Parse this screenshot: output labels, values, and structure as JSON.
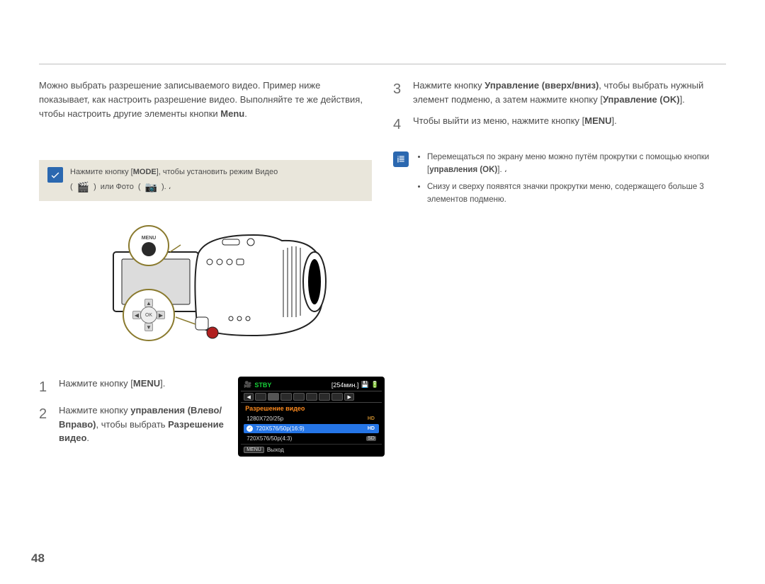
{
  "page_number": "48",
  "left": {
    "intro": "Можно выбрать разрешение записываемого видео.",
    "menu_word": "Menu",
    "preverify": {
      "line1_prefix": "Нажмите кнопку [",
      "mode": "MODE",
      "line1_suffix": "], чтобы установить режим Видео",
      "line2_prefix": "( ",
      "line2_mid": " ) или Фото ( ",
      "line2_suffix": " ). ،",
      "video_glyph": "🎬",
      "photo_glyph": "📷"
    },
    "callout_menu_label": "MENU",
    "navpad_ok": "OK",
    "step1_num": "1",
    "step1_a": "Нажмите кнопку [",
    "step1_menu": "MENU",
    "step1_b": "].",
    "step2_num": "2",
    "step2_a": "Нажмите кнопку ",
    "step2_b": "управления",
    "step2_c": " (Влево/Вправо)",
    "step2_d": ", чтобы выбрать ",
    "step2_e": "Разрешение видео",
    "step2_f": "."
  },
  "lcd": {
    "stby": "STBY",
    "time": "[254мин.]",
    "title": "Разрешение видео",
    "rows": [
      {
        "label": "1280X720/25p",
        "tag": "HD"
      },
      {
        "label": "720X576/50p(16:9)",
        "tag": "HD"
      },
      {
        "label": "720X576/50p(4:3)",
        "tag": "SD"
      }
    ],
    "menu_btn": "MENU",
    "exit": "Выход"
  },
  "right": {
    "step3_num": "3",
    "step3_a": "Нажмите кнопку ",
    "step3_b": "Управление (вверх/вниз)",
    "step3_c": ", чтобы выбрать нужный элемент подменю, а затем нажмите кнопку [",
    "step3_d": "Управление (OK)",
    "step3_e": "].",
    "step4_num": "4",
    "step4_a": "Чтобы выйти из меню, нажмите кнопку [",
    "step4_menu": "MENU",
    "step4_b": "].",
    "note1_a": "Перемещаться по экрану меню можно путём прокрутки с помощью кнопки [",
    "note1_b": "управления (OK)",
    "note1_c": "].  ،",
    "note2": "Снизу и сверху появятся значки прокрутки меню, содержащего больше 3 элементов подменю."
  }
}
